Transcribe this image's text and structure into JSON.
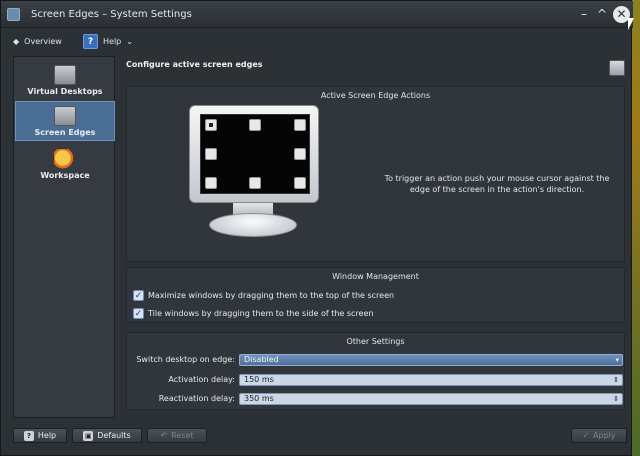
{
  "window": {
    "title": "Screen Edges – System Settings"
  },
  "titlebar": {
    "minimize": "–",
    "maximize": "^",
    "close": "✕"
  },
  "toolbar": {
    "overview_label": "Overview",
    "help_label": "Help",
    "help_badge": "?"
  },
  "sidebar": {
    "items": [
      {
        "label": "Virtual Desktops",
        "icon": "desktop-switch-icon"
      },
      {
        "label": "Screen Edges",
        "icon": "screen-edges-icon",
        "active": true
      },
      {
        "label": "Workspace",
        "icon": "workspace-icon"
      }
    ]
  },
  "main": {
    "heading": "Configure active screen edges",
    "actions_group": {
      "title": "Active Screen Edge Actions",
      "hint": "To trigger an action push your mouse cursor against the edge of the screen in the action's direction."
    },
    "window_management": {
      "title": "Window Management",
      "options": [
        {
          "label": "Maximize windows by dragging them to the top of the screen",
          "checked": true
        },
        {
          "label": "Tile windows by dragging them to the side of the screen",
          "checked": true
        }
      ]
    },
    "other_settings": {
      "title": "Other Settings",
      "switch_desktop_label": "Switch desktop on edge:",
      "switch_desktop_value": "Disabled",
      "activation_label": "Activation delay:",
      "activation_value": "150 ms",
      "reactivation_label": "Reactivation delay:",
      "reactivation_value": "350 ms"
    }
  },
  "buttons": {
    "help": "Help",
    "defaults": "Defaults",
    "reset": "Reset",
    "apply": "Apply"
  }
}
